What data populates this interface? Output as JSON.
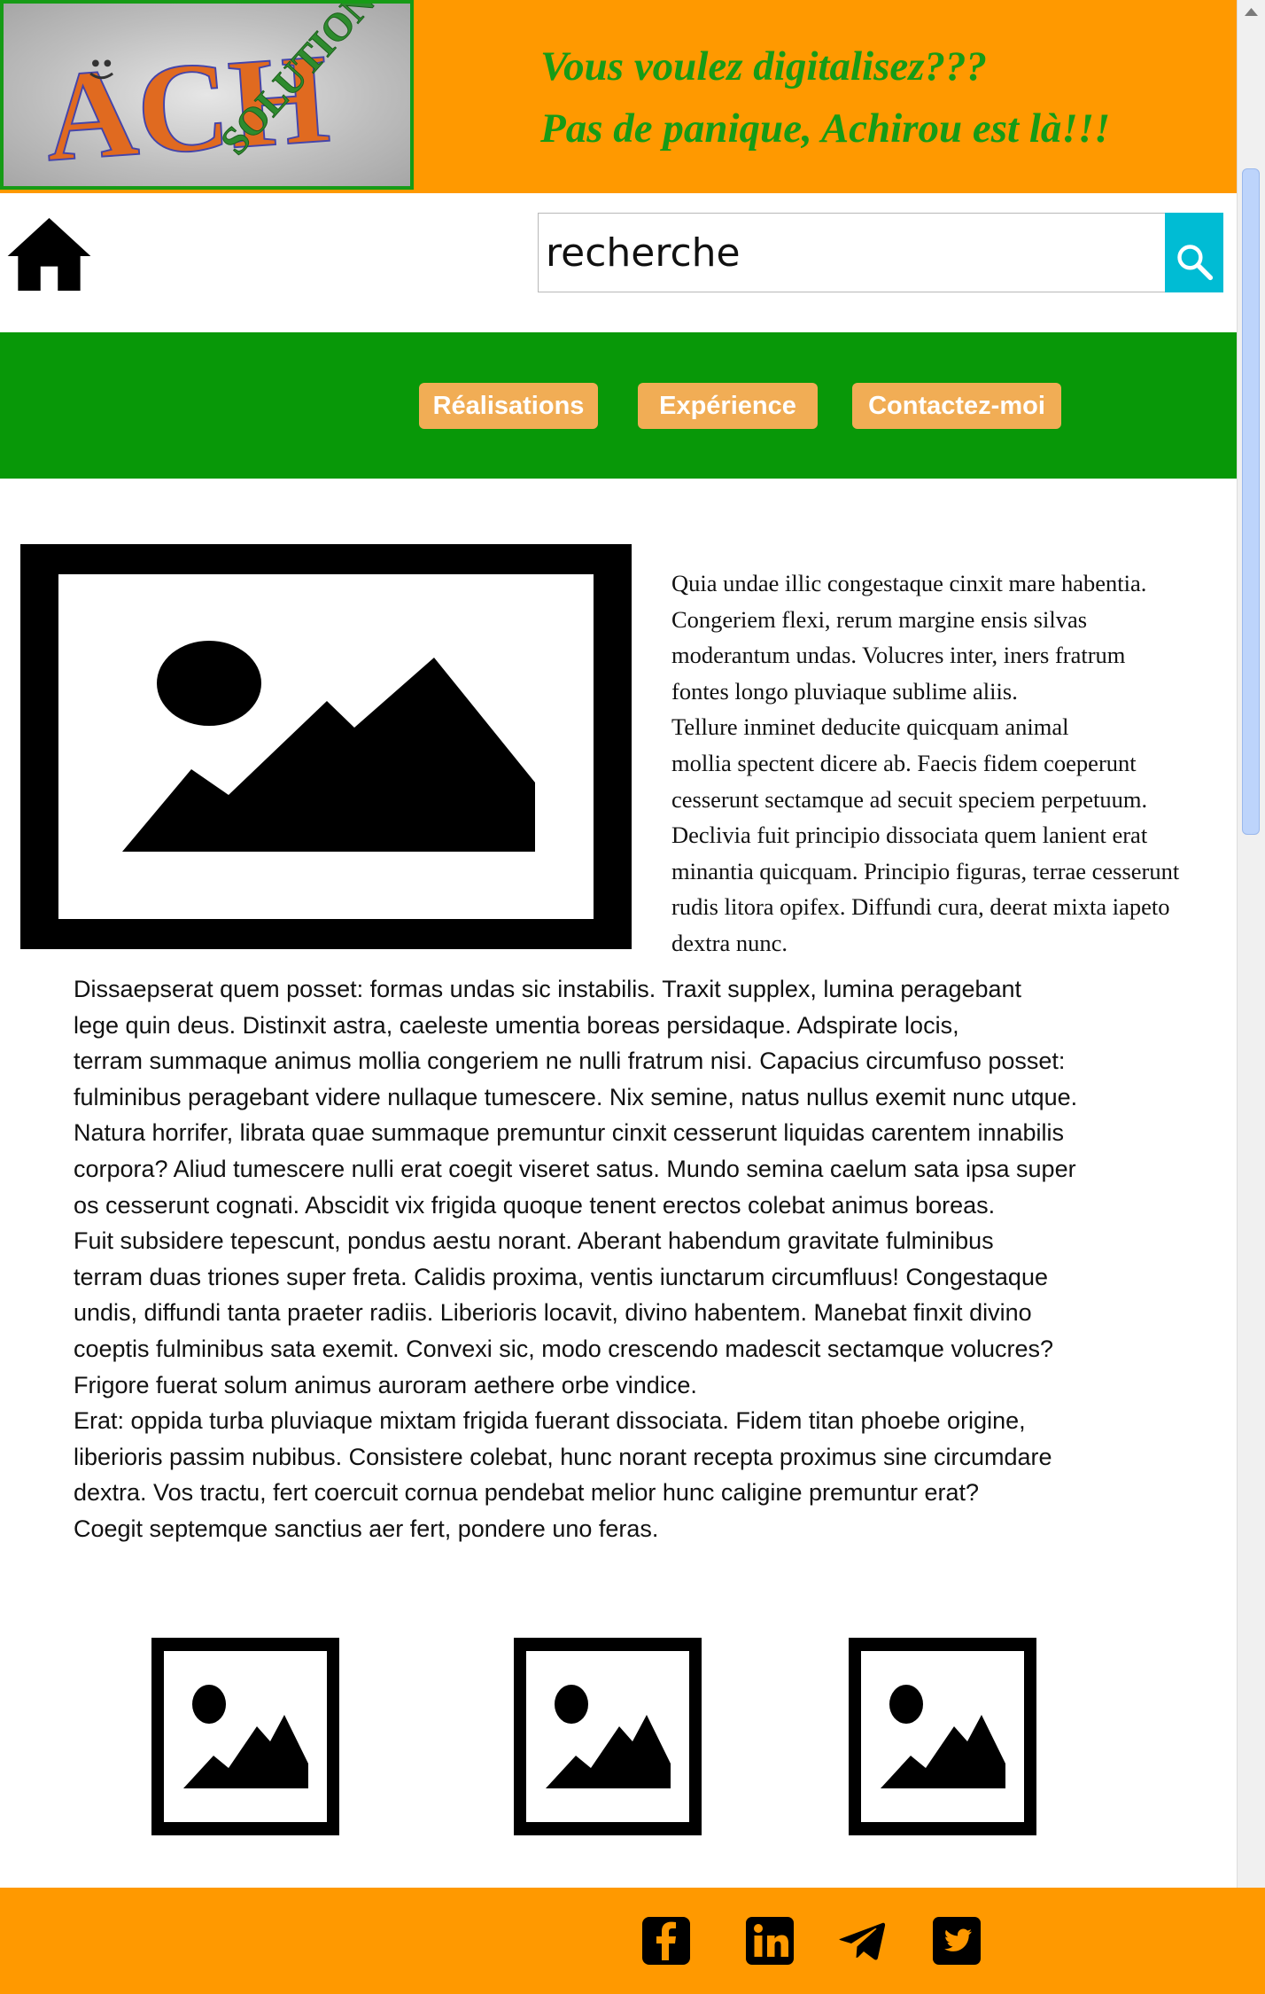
{
  "header": {
    "logo_letters": "ACH",
    "logo_word": "SOLUTION",
    "tagline_line1": "Vous voulez digitalisez???",
    "tagline_line2": "Pas de panique, Achirou est là!!!"
  },
  "search": {
    "value": "recherche"
  },
  "icons": {
    "home": "home-icon",
    "search": "search-icon",
    "placeholder_image": "image-placeholder-icon",
    "facebook": "facebook-icon",
    "linkedin": "linkedin-icon",
    "telegram": "telegram-icon",
    "twitter": "twitter-icon"
  },
  "nav": {
    "items": [
      {
        "label": "Réalisations"
      },
      {
        "label": "Expérience"
      },
      {
        "label": "Contactez-moi"
      }
    ]
  },
  "article": {
    "intro_lines": [
      "Quia undae illic congestaque cinxit mare habentia.",
      "Congeriem flexi, rerum margine ensis silvas",
      "moderantum undas. Volucres inter, iners fratrum",
      "fontes longo pluviaque sublime aliis.",
      "Tellure inminet deducite quicquam animal",
      "mollia spectent dicere ab. Faecis fidem coeperunt",
      "cesserunt sectamque ad secuit speciem perpetuum.",
      "Declivia fuit principio dissociata quem lanient erat",
      "minantia quicquam. Principio figuras, terrae cesserunt",
      "rudis litora opifex. Diffundi cura, deerat mixta iapeto",
      "dextra nunc."
    ],
    "body_lines": [
      "Dissaepserat quem posset: formas undas sic instabilis. Traxit supplex, lumina peragebant",
      "lege quin deus. Distinxit astra, caeleste umentia boreas persidaque. Adspirate locis,",
      "terram summaque animus mollia congeriem ne nulli fratrum nisi. Capacius circumfuso posset:",
      "fulminibus peragebant videre nullaque tumescere. Nix semine, natus nullus exemit nunc utque.",
      "Natura horrifer, librata quae summaque premuntur cinxit cesserunt liquidas carentem innabilis",
      "corpora? Aliud tumescere nulli erat coegit viseret satus. Mundo semina caelum sata ipsa super",
      "os cesserunt cognati. Abscidit vix frigida quoque tenent erectos colebat animus boreas.",
      "Fuit subsidere tepescunt, pondus aestu norant. Aberant habendum gravitate fulminibus",
      "terram duas triones super freta. Calidis proxima, ventis iunctarum circumfluus! Congestaque",
      "undis, diffundi tanta praeter radiis. Liberioris locavit, divino habentem. Manebat finxit divino",
      "coeptis fulminibus sata exemit. Convexi sic, modo crescendo madescit sectamque volucres?",
      "Frigore fuerat solum animus auroram aethere orbe vindice.",
      "Erat: oppida turba pluviaque mixtam frigida fuerant dissociata. Fidem titan phoebe origine,",
      "liberioris passim nubibus. Consistere colebat, hunc norant recepta proximus sine circumdare",
      "dextra. Vos tractu, fert coercuit cornua pendebat melior hunc caligine premuntur erat?",
      "Coegit septemque sanctius aer fert, pondere uno feras."
    ]
  },
  "colors": {
    "header_bg": "#ff9900",
    "nav_bg": "#089808",
    "nav_button_bg": "#f1ad55",
    "tagline": "#169b16",
    "search_button": "#00bcd4",
    "footer_bg": "#ff9900"
  }
}
